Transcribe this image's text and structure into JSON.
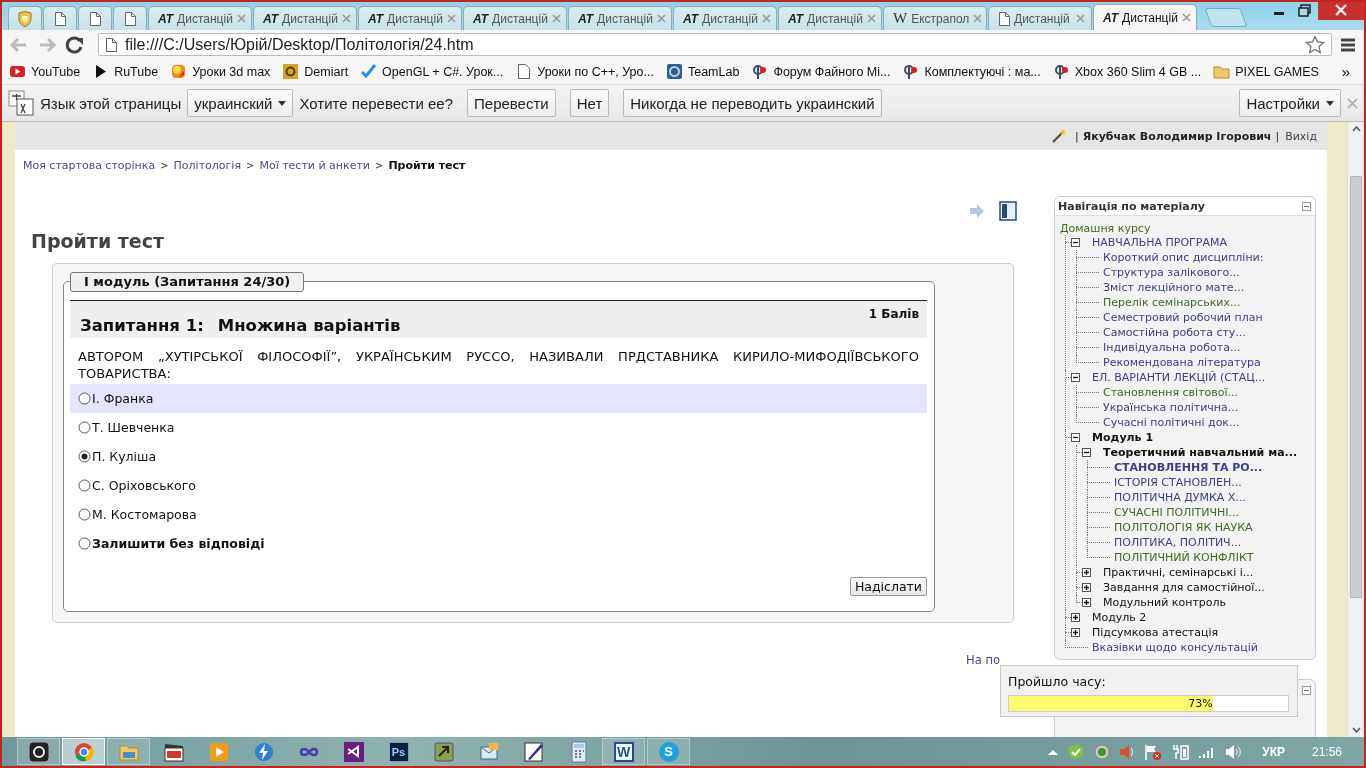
{
  "tabs": [
    {
      "kind": "pinned-shield",
      "selected": false
    },
    {
      "kind": "pinned-page",
      "selected": false
    },
    {
      "kind": "pinned-page",
      "selected": false
    },
    {
      "kind": "pinned-page",
      "selected": false
    },
    {
      "kind": "badge",
      "badge": "AT",
      "title": "Дистанцій",
      "selected": false
    },
    {
      "kind": "badge",
      "badge": "AT",
      "title": "Дистанцій",
      "selected": false
    },
    {
      "kind": "badge",
      "badge": "AT",
      "title": "Дистанцій",
      "selected": false
    },
    {
      "kind": "badge",
      "badge": "AT",
      "title": "Дистанцій",
      "selected": false
    },
    {
      "kind": "badge",
      "badge": "AT",
      "title": "Дистанцій",
      "selected": false
    },
    {
      "kind": "badge",
      "badge": "AT",
      "title": "Дистанцій",
      "selected": false
    },
    {
      "kind": "badge",
      "badge": "AT",
      "title": "Дистанцій",
      "selected": false
    },
    {
      "kind": "serif-badge",
      "badge": "W",
      "title": "Екстрапол",
      "selected": false
    },
    {
      "kind": "page",
      "title": "Дистанцій",
      "selected": false
    },
    {
      "kind": "badge",
      "badge": "AT",
      "title": "Дистанцій",
      "selected": true
    }
  ],
  "toolbar": {
    "back_disabled": true,
    "forward_disabled": true,
    "url": "file:///C:/Users/Юрій/Desktop/Політологія/24.htm"
  },
  "bookmarks": [
    {
      "kind": "red-play",
      "label": "YouTube"
    },
    {
      "kind": "black-play",
      "label": "RuTube"
    },
    {
      "kind": "ball",
      "label": "Уроки 3d max"
    },
    {
      "kind": "gold-square",
      "label": "Demiart"
    },
    {
      "kind": "check",
      "label": "OpenGL + C#. Урок..."
    },
    {
      "kind": "page",
      "label": "Уроки по C++, Уро..."
    },
    {
      "kind": "blue-square",
      "label": "TeamLab"
    },
    {
      "kind": "pin",
      "label": "Форум Файного Мі..."
    },
    {
      "kind": "pin",
      "label": "Комплектуючі : ма..."
    },
    {
      "kind": "pin",
      "label": "Xbox 360 Slim 4 GB ..."
    },
    {
      "kind": "folder",
      "label": "PIXEL GAMES"
    }
  ],
  "bookmarks_more": "»",
  "translate_bar": {
    "label": "Язык этой страницы",
    "language": "украинский",
    "question": "Хотите перевести ее?",
    "buttons": [
      "Перевести",
      "Нет",
      "Никогда не переводить украинский"
    ],
    "options": "Настройки"
  },
  "user_bar": {
    "separator_left": "|",
    "user": "Якубчак Володимир Ігорович",
    "separator_right": "|",
    "logout": "Вихід"
  },
  "breadcrumb": [
    {
      "kind": "link",
      "text": "Моя стартова сторінка"
    },
    {
      "kind": "separator",
      "text": ">"
    },
    {
      "kind": "link",
      "text": "Політологія"
    },
    {
      "kind": "separator",
      "text": ">"
    },
    {
      "kind": "link",
      "text": "Мої тести й анкети"
    },
    {
      "kind": "separator",
      "text": ">"
    },
    {
      "kind": "current",
      "text": "Пройти тест"
    }
  ],
  "page_title": "Пройти тест",
  "quiz": {
    "legend": "І модуль (Запитання 24/30)",
    "number": "Запитання 1:",
    "type": "Множина варіантів",
    "points": "1 Балів",
    "question": "АВТОРОМ „ХУТІРСЬКОЇ ФІЛОСОФІЇ”, УКРАЇНСЬКИМ РУССО, НАЗИВАЛИ ПРДСТАВНИКА КИРИЛО-МИФОДІЇВСЬКОГО ТОВАРИСТВА:",
    "options": [
      {
        "kind": "answer",
        "text": "І. Франка",
        "selected": false,
        "highlighted": true
      },
      {
        "kind": "answer",
        "text": "Т. Шевченка",
        "selected": false,
        "highlighted": false
      },
      {
        "kind": "answer",
        "text": "П. Куліша",
        "selected": true,
        "highlighted": false
      },
      {
        "kind": "answer",
        "text": "С. Оріховського",
        "selected": false,
        "highlighted": false
      },
      {
        "kind": "answer",
        "text": "М. Костомарова",
        "selected": false,
        "highlighted": false
      },
      {
        "kind": "no-answer",
        "text": "Залишити без відповіді",
        "selected": false,
        "highlighted": false
      }
    ],
    "submit": "Надіслати"
  },
  "footer_text": "На по",
  "navigation": {
    "title": "Навігація по матеріалу",
    "home": "Домашня курсу",
    "tree": [
      {
        "kind": "link",
        "text": "НАВЧАЛЬНА ПРОГРАМА",
        "visited": false,
        "current": false,
        "expanded": true,
        "children": [
          {
            "kind": "link",
            "text": "Короткий опис дисципліни:",
            "visited": false,
            "current": false
          },
          {
            "kind": "link",
            "text": "Структура залікового...",
            "visited": false,
            "current": false
          },
          {
            "kind": "link",
            "text": "Зміст лекційного мате...",
            "visited": false,
            "current": false
          },
          {
            "kind": "link",
            "text": "Перелік семінарських...",
            "visited": true,
            "current": false
          },
          {
            "kind": "link",
            "text": "Семестровий робочий план",
            "visited": false,
            "current": false
          },
          {
            "kind": "link",
            "text": "Самостійна робота сту...",
            "visited": false,
            "current": false
          },
          {
            "kind": "link",
            "text": "Індивідуальна робота...",
            "visited": false,
            "current": false
          },
          {
            "kind": "link",
            "text": "Рекомендована література",
            "visited": false,
            "current": false
          }
        ]
      },
      {
        "kind": "link",
        "text": "ЕЛ. ВАРІАНТИ ЛЕКЦІЙ (СТАЦ...",
        "visited": false,
        "current": false,
        "expanded": true,
        "children": [
          {
            "kind": "link",
            "text": "Становлення світової...",
            "visited": true,
            "current": false
          },
          {
            "kind": "link",
            "text": "Українська політична...",
            "visited": false,
            "current": false
          },
          {
            "kind": "link",
            "text": "Сучасні політичні док...",
            "visited": false,
            "current": false
          }
        ]
      },
      {
        "kind": "heading",
        "text": "Модуль 1",
        "current": true,
        "expanded": true,
        "children": [
          {
            "kind": "heading",
            "text": "Теоретичний навчальний ма...",
            "current": true,
            "expanded": true,
            "children": [
              {
                "kind": "link",
                "text": "СТАНОВЛЕННЯ ТА РО...",
                "visited": false,
                "current": true
              },
              {
                "kind": "link",
                "text": "ІСТОРІЯ СТАНОВЛЕН...",
                "visited": false,
                "current": false
              },
              {
                "kind": "link",
                "text": "ПОЛІТИЧНА ДУМКА Х...",
                "visited": false,
                "current": false
              },
              {
                "kind": "link",
                "text": "СУЧАСНІ ПОЛІТИЧНІ...",
                "visited": true,
                "current": false
              },
              {
                "kind": "link",
                "text": "ПОЛІТОЛОГІЯ ЯК НАУКА",
                "visited": true,
                "current": false
              },
              {
                "kind": "link",
                "text": "ПОЛІТИКА, ПОЛІТИЧ...",
                "visited": false,
                "current": false
              },
              {
                "kind": "link",
                "text": "ПОЛІТИЧНИЙ КОНФЛІКТ",
                "visited": true,
                "current": false
              }
            ]
          },
          {
            "kind": "heading",
            "text": "Практичні, семінарські і...",
            "current": false,
            "expanded": false
          },
          {
            "kind": "heading",
            "text": "Завдання для самостійної...",
            "current": false,
            "expanded": false
          },
          {
            "kind": "heading",
            "text": "Модульний контроль",
            "current": false,
            "expanded": false
          }
        ]
      },
      {
        "kind": "heading",
        "text": "Модуль 2",
        "current": false,
        "expanded": false
      },
      {
        "kind": "heading",
        "text": "Підсумкова атестація",
        "current": false,
        "expanded": false
      },
      {
        "kind": "link",
        "text": "Вказівки щодо консультацій",
        "visited": false,
        "current": false
      }
    ]
  },
  "timer": {
    "label": "Пройшло часу:",
    "level": 0.73,
    "reading": "73%"
  },
  "taskbar": {
    "apps": [
      {
        "kind": "ring",
        "running": true,
        "selected": false
      },
      {
        "kind": "browser",
        "running": true,
        "selected": true
      },
      {
        "kind": "folder",
        "running": true,
        "selected": false
      },
      {
        "kind": "clapper",
        "running": false,
        "selected": false
      },
      {
        "kind": "play",
        "running": false,
        "selected": false
      },
      {
        "kind": "lightning",
        "running": false,
        "selected": false
      },
      {
        "kind": "infinity",
        "running": false,
        "selected": false
      },
      {
        "kind": "ribbon",
        "running": false,
        "selected": false
      },
      {
        "kind": "letter-dark",
        "letter": "Ps",
        "running": false,
        "selected": false
      },
      {
        "kind": "arrow-tile",
        "running": false,
        "selected": false
      },
      {
        "kind": "envelope",
        "running": false,
        "selected": false
      },
      {
        "kind": "pen",
        "running": false,
        "selected": false
      },
      {
        "kind": "calculator",
        "running": false,
        "selected": false
      },
      {
        "kind": "letter-word",
        "letter": "W",
        "running": true,
        "selected": false
      },
      {
        "kind": "letter-bubble",
        "letter": "S",
        "running": true,
        "selected": false
      }
    ],
    "language": "УКР",
    "time": "21:56"
  }
}
